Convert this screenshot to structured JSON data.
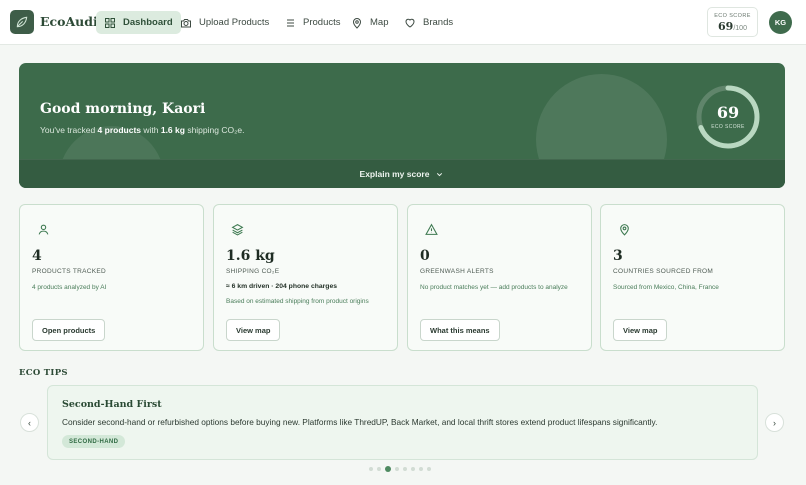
{
  "app": {
    "name": "EcoAudit"
  },
  "nav": {
    "items": [
      {
        "label": "Dashboard",
        "icon": "grid-icon",
        "active": true
      },
      {
        "label": "Upload Products",
        "icon": "camera-icon"
      },
      {
        "label": "Products",
        "icon": "list-icon"
      },
      {
        "label": "Map",
        "icon": "map-pin-icon"
      },
      {
        "label": "Brands",
        "icon": "heart-icon"
      }
    ],
    "score_label": "ECO SCORE",
    "score_value": "69",
    "score_max": "/100",
    "avatar_initials": "KG"
  },
  "hero": {
    "greeting": "Good morning, Kaori",
    "summary_prefix": "You've tracked ",
    "summary_products": "4 products",
    "summary_mid": " with ",
    "summary_co2": "1.6 kg",
    "summary_suffix": " shipping CO₂e.",
    "score": "69",
    "score_fraction": 0.69,
    "score_label": "ECO SCORE",
    "explain_label": "Explain my score"
  },
  "cards": [
    {
      "icon": "user-icon",
      "value": "4",
      "label": "PRODUCTS TRACKED",
      "desc": "4 products analyzed by AI",
      "button": "Open products"
    },
    {
      "icon": "layers-icon",
      "value": "1.6 kg",
      "label": "SHIPPING CO₂E",
      "highlight": "≈ 6 km driven · 204 phone charges",
      "desc": "Based on estimated shipping from product origins",
      "button": "View map"
    },
    {
      "icon": "alert-triangle-icon",
      "value": "0",
      "label": "GREENWASH ALERTS",
      "desc": "No product matches yet — add products to analyze",
      "button": "What this means"
    },
    {
      "icon": "map-pin-icon",
      "value": "3",
      "label": "COUNTRIES SOURCED FROM",
      "desc": "Sourced from Mexico, China, France",
      "button": "View map"
    }
  ],
  "tips": {
    "title": "ECO TIPS",
    "current": {
      "title": "Second-Hand First",
      "text": "Consider second-hand or refurbished options before buying new. Platforms like ThredUP, Back Market, and local thrift stores extend product lifespans significantly.",
      "tag": "SECOND-HAND"
    },
    "prev_label": "‹",
    "next_label": "›",
    "dot_count": 8,
    "active_dot": 2
  },
  "colors": {
    "brand": "#3d6b4b",
    "accent": "#4e8a61"
  }
}
